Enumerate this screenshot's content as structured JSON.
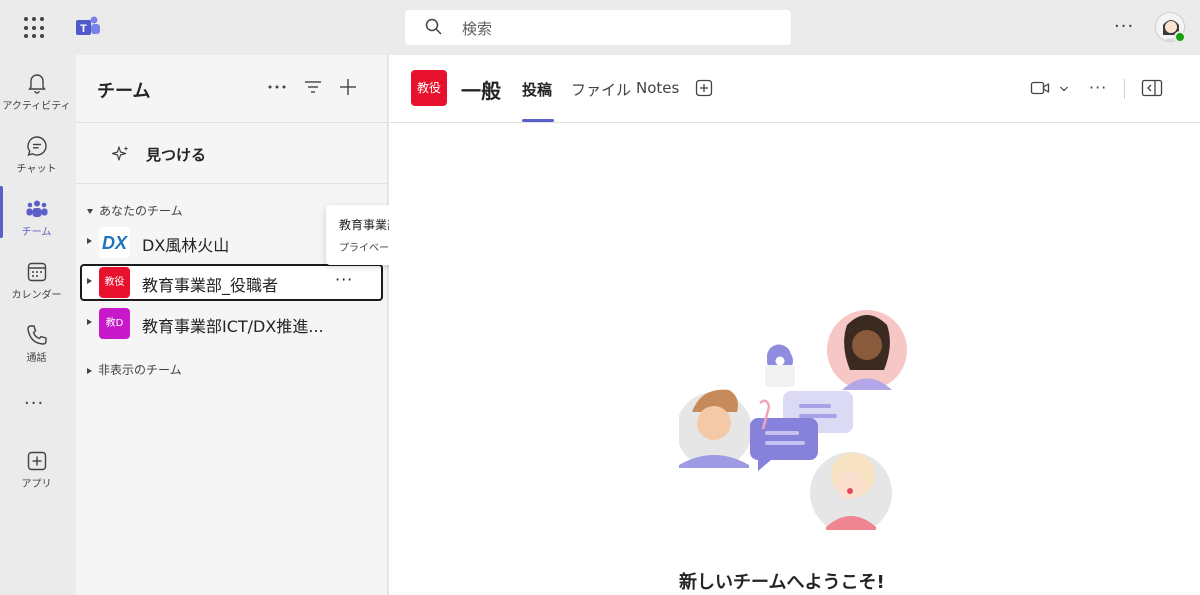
{
  "top": {
    "search_placeholder": "検索"
  },
  "rail": {
    "items": [
      {
        "label": "アクティビティ"
      },
      {
        "label": "チャット"
      },
      {
        "label": "チーム"
      },
      {
        "label": "カレンダー"
      },
      {
        "label": "通話"
      },
      {
        "label": "アプリ"
      }
    ],
    "active_index": 2,
    "accent_color": "#5b5fc7"
  },
  "panel": {
    "title": "チーム",
    "discover_label": "見つける",
    "your_teams_label": "あなたのチーム",
    "hidden_teams_label": "非表示のチーム",
    "teams": [
      {
        "name": "DX風林火山",
        "tile_text": "DX",
        "tile_color": "#1e73be"
      },
      {
        "name": "教育事業部_役職者",
        "tile_text": "教役",
        "tile_color": "#e8112d"
      },
      {
        "name": "教育事業部ICT/DX推進...",
        "tile_text": "教D",
        "tile_color": "#c719c9"
      }
    ],
    "tooltip": {
      "title": "教育事業部_役職者",
      "subtitle": "プライベート"
    }
  },
  "main": {
    "tile_text": "教役",
    "channel_name": "一般",
    "tabs": [
      {
        "label": "投稿"
      },
      {
        "label": "ファイル"
      },
      {
        "label": "Notes"
      }
    ],
    "welcome_text": "新しいチームへようこそ!"
  }
}
